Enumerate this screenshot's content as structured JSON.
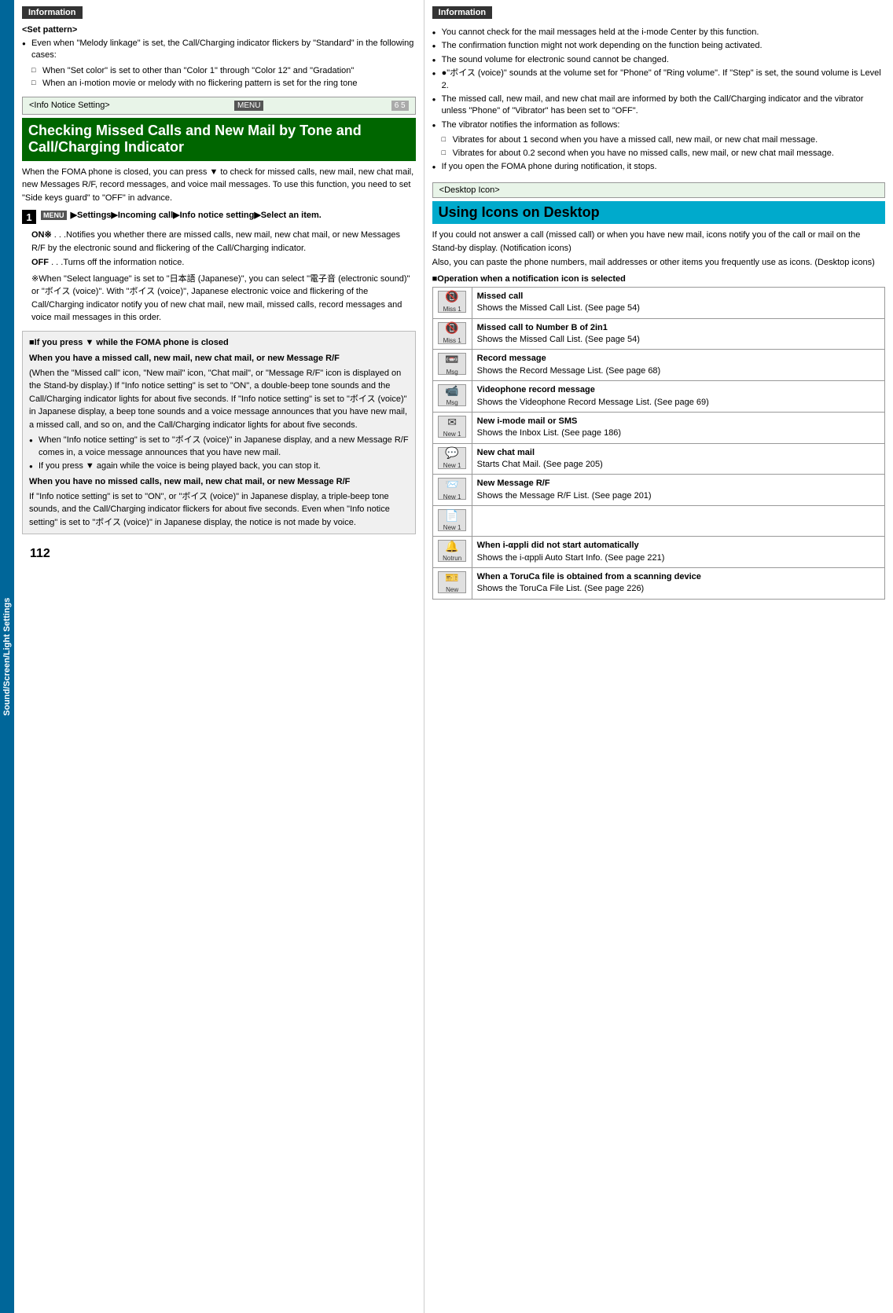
{
  "left": {
    "info_badge": "Information",
    "set_pattern_title": "<Set pattern>",
    "set_pattern_bullets": [
      "Even when \"Melody linkage\" is set, the Call/Charging indicator flickers by \"Standard\" in the following cases:"
    ],
    "set_pattern_sub": [
      "When \"Set color\" is set to other than \"Color 1\" through \"Color 12\" and \"Gradation\"",
      "When an i-motion movie or melody with no flickering pattern is set for the ring tone"
    ],
    "notice_header_label": "<Info Notice Setting>",
    "menu_icon": "MENU",
    "menu_code": "6 5",
    "notice_title": "Checking Missed Calls and New Mail by Tone and Call/Charging Indicator",
    "notice_body": "When the FOMA phone is closed, you can press ▼ to check for missed calls, new mail, new chat mail, new Messages R/F, record messages, and voice mail messages. To use this function, you need to set \"Side keys guard\" to \"OFF\" in advance.",
    "step1_content": "▶Settings▶Incoming call▶Info notice setting▶Select an item.",
    "on_label": "ON※",
    "on_text": ". . .Notifies you whether there are missed calls, new mail, new chat mail, or new Messages R/F by the electronic sound and flickering of the Call/Charging indicator.",
    "off_label": "OFF",
    "off_text": ". . .Turns off the information notice.",
    "note_text": "※When \"Select language\" is set to \"日本語 (Japanese)\", you can select \"電子音 (electronic sound)\" or \"ボイス (voice)\". With \"ボイス (voice)\", Japanese electronic voice and flickering of the Call/Charging indicator notify you of new chat mail, new mail, missed calls, record messages and voice mail messages in this order.",
    "gray_box_title": "■If you press ▼ while the FOMA phone is closed",
    "gray_box_missed": "When you have a missed call, new mail, new chat mail, or new Message R/F",
    "gray_box_missed_text": "(When the \"Missed call\" icon, \"New mail\" icon, \"Chat mail\", or \"Message R/F\" icon is displayed on the Stand-by display.) If \"Info notice setting\" is set to \"ON\", a double-beep tone sounds and the Call/Charging indicator lights for about five seconds. If \"Info notice setting\" is set to \"ボイス (voice)\" in Japanese display, a beep tone sounds and a voice message announces that you have new mail, a missed call, and so on, and the Call/Charging indicator lights for about five seconds.",
    "gray_box_bullet1": "When \"Info notice setting\" is set to \"ボイス (voice)\" in Japanese display, and a new Message R/F comes in, a voice message announces that you have new mail.",
    "gray_box_bullet2": "If you press ▼ again while the voice is being played back, you can stop it.",
    "gray_box_no_missed": "When you have no missed calls, new mail, new chat mail, or new Message R/F",
    "gray_box_no_missed_text": "If \"Info notice setting\" is set to \"ON\", or \"ボイス (voice)\" in Japanese display, a triple-beep tone sounds, and the Call/Charging indicator flickers for about five seconds. Even when \"Info notice setting\" is set to \"ボイス (voice)\" in Japanese display, the notice is not made by voice.",
    "page_number": "112"
  },
  "right": {
    "info_badge": "Information",
    "right_bullets": [
      "You cannot check for the mail messages held at the i-mode Center by this function.",
      "The confirmation function might not work depending on the function being activated.",
      "The sound volume for electronic sound cannot be changed.",
      "●\"ボイス (voice)\" sounds at the volume set for \"Phone\" of \"Ring volume\". If \"Step\" is set, the sound volume is Level 2.",
      "The missed call, new mail, and new chat mail are informed by both the Call/Charging indicator and the vibrator unless \"Phone\" of \"Vibrator\" has been set to \"OFF\".",
      "The vibrator notifies the information as follows:"
    ],
    "vibrator_sub": [
      "Vibrates for about 1 second when you have a missed call, new mail, or new chat mail message.",
      "Vibrates for about 0.2 second when you have no missed calls, new mail, or new chat mail message."
    ],
    "last_bullet": "If you open the FOMA phone during notification, it stops.",
    "desktop_header_label": "<Desktop Icon>",
    "desktop_title": "Using Icons on Desktop",
    "desktop_body_lines": [
      "If you could not answer a call (missed call) or when you have new mail, icons notify you of the call or mail on the Stand-by display. (Notification icons)",
      "Also, you can paste the phone numbers, mail addresses or other items you frequently use as icons. (Desktop icons)"
    ],
    "operation_title": "■Operation when a notification icon is selected",
    "icon_rows": [
      {
        "icon_label": "Miss 1",
        "icon_type": "missed_call",
        "title": "Missed call",
        "desc": "Shows the Missed Call List. (See page 54)"
      },
      {
        "icon_label": "Miss 1",
        "icon_type": "missed_call2",
        "title": "Missed call to Number B of 2in1",
        "desc": "Shows the Missed Call List. (See page 54)"
      },
      {
        "icon_label": "Msg",
        "icon_type": "record",
        "title": "Record message",
        "desc": "Shows the Record Message List. (See page 68)"
      },
      {
        "icon_label": "Msg",
        "icon_type": "video",
        "title": "Videophone record message",
        "desc": "Shows the Videophone Record Message List. (See page 69)"
      },
      {
        "icon_label": "New 1",
        "icon_type": "imode",
        "title": "New i-mode mail or SMS",
        "desc": "Shows the Inbox List. (See page 186)"
      },
      {
        "icon_label": "New 1",
        "icon_type": "chat",
        "title": "New chat mail",
        "desc": "Starts Chat Mail. (See page 205)"
      },
      {
        "icon_label": "New 1",
        "icon_type": "msgrf",
        "title": "New Message R/F",
        "desc": "Shows the Message R/F List. (See page 201)"
      },
      {
        "icon_label": "New 1",
        "icon_type": "msgrf2",
        "title": "",
        "desc": ""
      },
      {
        "icon_label": "Notrun",
        "icon_type": "ippli",
        "title": "When i-αppli did not start automatically",
        "desc": "Shows the i-αppli Auto Start Info. (See page 221)"
      },
      {
        "icon_label": "New",
        "icon_type": "toruca",
        "title": "When a ToruCa file is obtained from a scanning device",
        "desc": "Shows the ToruCa File List. (See page 226)"
      }
    ]
  }
}
